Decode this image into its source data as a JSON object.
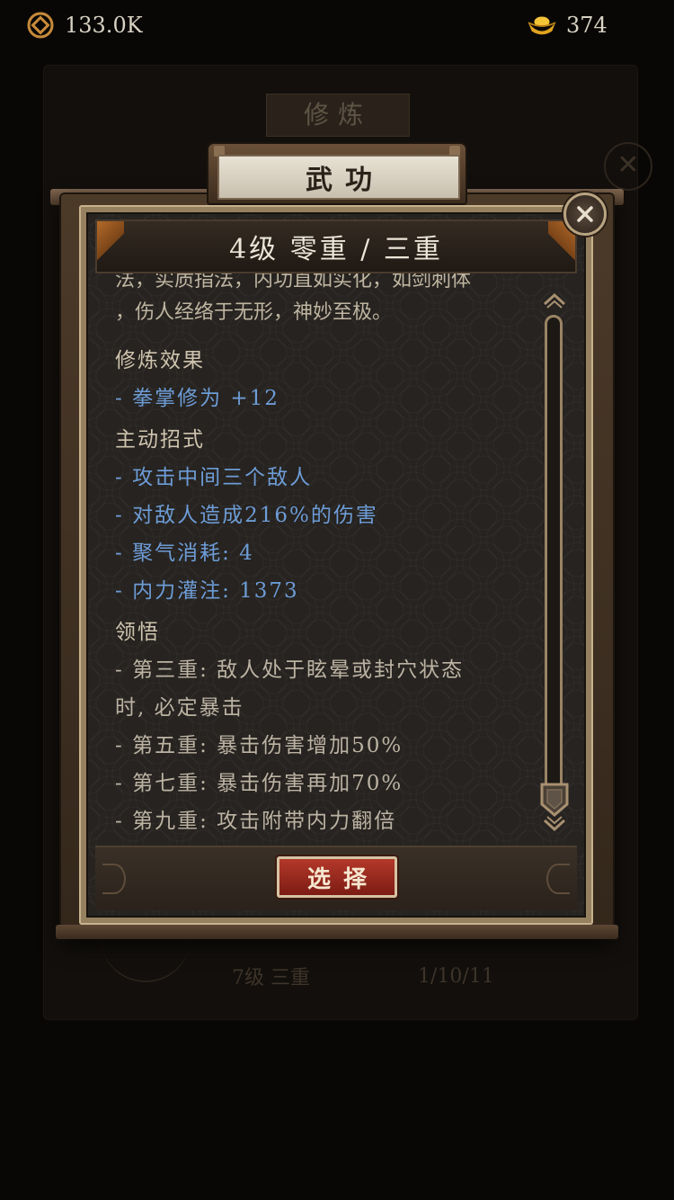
{
  "currency": {
    "coins_icon": "coin-icon",
    "coins": "133.0K",
    "gold_icon": "gold-ingot-icon",
    "gold": "374"
  },
  "background": {
    "tab_label": "修炼",
    "row_text_1": "7级 三重",
    "row_text_2": "1/10/11"
  },
  "dialog": {
    "title": "武功",
    "level_header": "4级 零重 / 三重",
    "description_clipped": "法，实质指法，内功直如实化，如剑刺体",
    "description": "，伤人经络于无形，神妙至极。",
    "sections": [
      {
        "heading": "修炼效果",
        "items": [
          {
            "text": "- 拳掌修为 +12",
            "style": "blue"
          }
        ]
      },
      {
        "heading": "主动招式",
        "items": [
          {
            "text": "- 攻击中间三个敌人",
            "style": "blue"
          },
          {
            "text": "- 对敌人造成216%的伤害",
            "style": "blue"
          },
          {
            "text": "- 聚气消耗: 4",
            "style": "blue"
          },
          {
            "text": "- 内力灌注: 1373",
            "style": "blue"
          }
        ]
      },
      {
        "heading": "领悟",
        "items": [
          {
            "text": "- 第三重: 敌人处于眩晕或封穴状态",
            "style": "grey"
          },
          {
            "text": "时, 必定暴击",
            "style": "grey"
          },
          {
            "text": "- 第五重: 暴击伤害增加50%",
            "style": "grey"
          },
          {
            "text": "- 第七重: 暴击伤害再加70%",
            "style": "grey"
          },
          {
            "text": "- 第九重: 攻击附带内力翻倍",
            "style": "grey"
          }
        ]
      }
    ],
    "select_label": "选择",
    "close_icon": "close-icon"
  },
  "colors": {
    "blue_text": "#6d9cd6",
    "select_button": "#a3291f",
    "frame_gold": "#c7b28c"
  }
}
